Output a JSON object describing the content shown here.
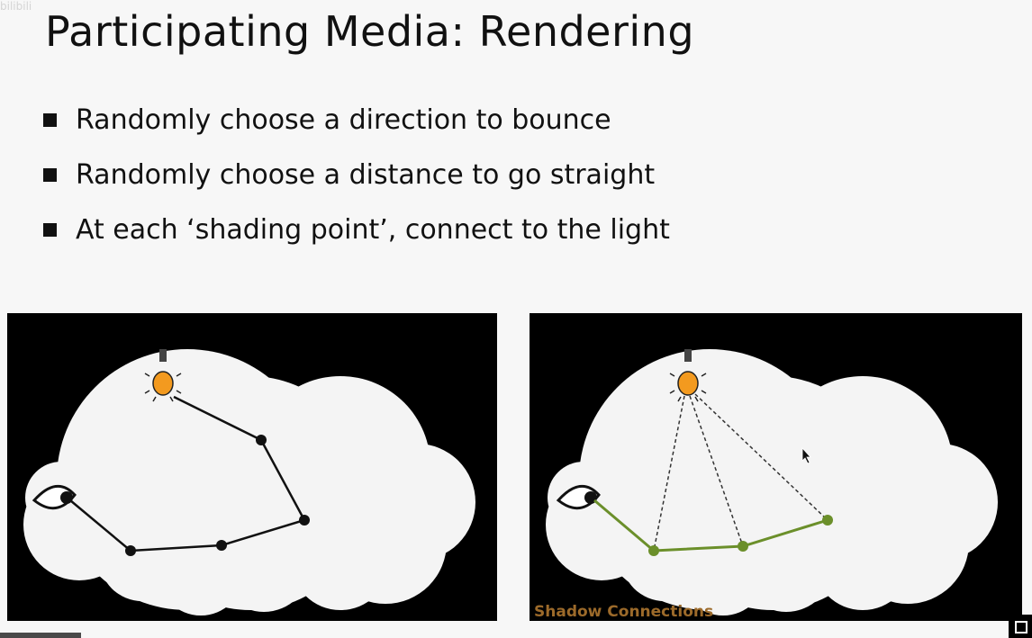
{
  "slide": {
    "title": "Participating Media: Rendering",
    "watermark": "bilibili",
    "bullets": [
      "Randomly choose a direction to bounce",
      "Randomly choose a distance to go straight",
      "At each ‘shading point’, connect to the light"
    ]
  },
  "figures": {
    "right_caption": "Shadow Connections"
  },
  "colors": {
    "panel_bg": "#000000",
    "cloud": "#f4f4f4",
    "bulb": "#f39a1f",
    "path_black": "#111111",
    "path_green": "#6b8f2a",
    "caption": "#9c6a2a"
  },
  "icons": [
    "eye-icon",
    "light-bulb-icon",
    "mouse-cursor-icon",
    "fullscreen-icon"
  ]
}
